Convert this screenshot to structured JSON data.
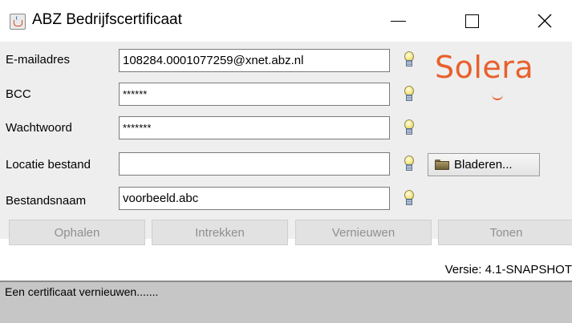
{
  "window": {
    "title": "ABZ Bedrijfscertificaat",
    "icon": "java-cup-icon",
    "controls": [
      "minimize-icon",
      "maximize-icon",
      "close-icon"
    ]
  },
  "logo": {
    "text": "Solera",
    "color": "#e8602c"
  },
  "form": {
    "email": {
      "label": "E-mailadres",
      "value": "108284.0001077259@xnet.abz.nl"
    },
    "bcc": {
      "label": "BCC",
      "value": "******"
    },
    "password": {
      "label": "Wachtwoord",
      "value": "*******"
    },
    "location": {
      "label": "Locatie bestand",
      "value": ""
    },
    "filename": {
      "label": "Bestandsnaam",
      "value": "voorbeeld.abc"
    },
    "hint_icon": "lightbulb-icon"
  },
  "browse_button": {
    "label": "Bladeren...",
    "icon": "folder-icon"
  },
  "actions": [
    {
      "label": "Ophalen",
      "enabled": false
    },
    {
      "label": "Intrekken",
      "enabled": false
    },
    {
      "label": "Vernieuwen",
      "enabled": false
    },
    {
      "label": "Tonen",
      "enabled": false
    }
  ],
  "version": "Versie: 4.1-SNAPSHOT",
  "status": "Een certificaat vernieuwen.......",
  "colors": {
    "accent": "#e8602c",
    "status_bg": "#c6c6c6",
    "form_bg": "#eeeeee"
  }
}
